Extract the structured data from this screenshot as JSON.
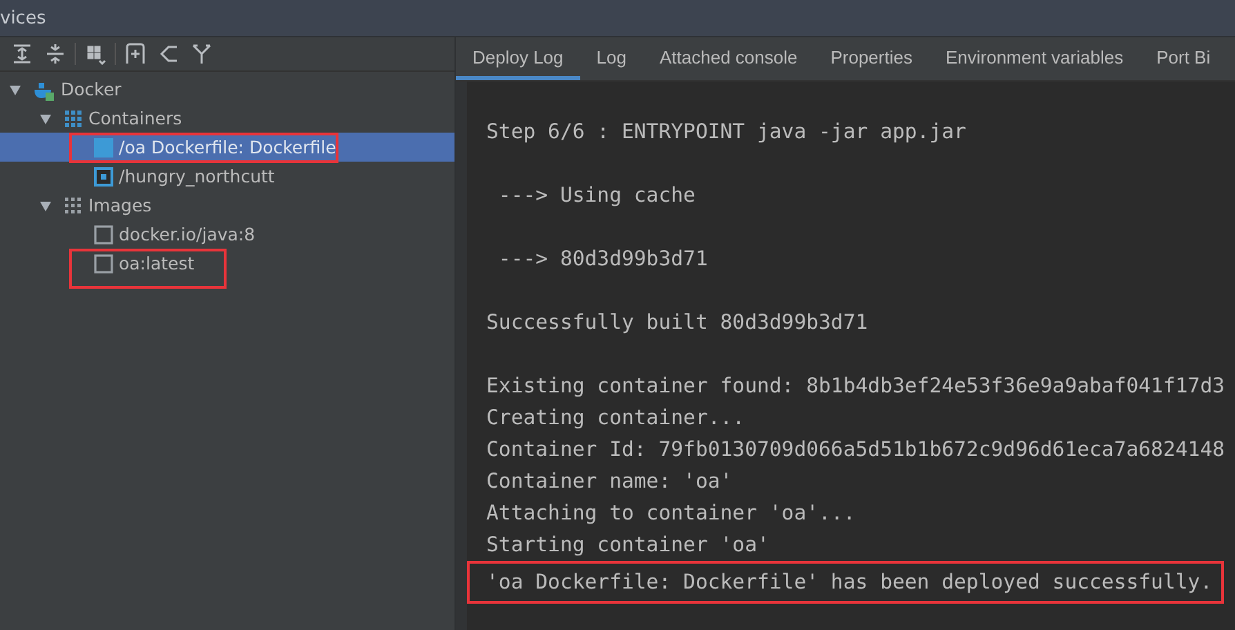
{
  "window": {
    "title": "vices"
  },
  "toolbar": {
    "buttons": [
      {
        "kind": "expand"
      },
      {
        "kind": "collapse"
      },
      {
        "kind": "group"
      },
      {
        "kind": "add"
      },
      {
        "kind": "share"
      },
      {
        "kind": "filter"
      }
    ]
  },
  "tree": [
    {
      "label": "Docker",
      "kind": "docker",
      "expanded": true,
      "selected": false,
      "highlighted": false,
      "children": [
        {
          "label": "Containers",
          "kind": "containers",
          "expanded": true,
          "selected": false,
          "highlighted": false,
          "children": [
            {
              "label": "/oa Dockerfile: Dockerfile",
              "kind": "container-stopped",
              "selected": true,
              "highlighted": true
            },
            {
              "label": "/hungry_northcutt",
              "kind": "container-running",
              "selected": false,
              "highlighted": false
            }
          ]
        },
        {
          "label": "Images",
          "kind": "images",
          "expanded": true,
          "selected": false,
          "highlighted": false,
          "children": [
            {
              "label": "docker.io/java:8",
              "kind": "image",
              "selected": false,
              "highlighted": false
            },
            {
              "label": "oa:latest",
              "kind": "image",
              "selected": false,
              "highlighted": true
            }
          ]
        }
      ]
    }
  ],
  "tabs": [
    {
      "label": "Deploy Log",
      "selected": true
    },
    {
      "label": "Log",
      "selected": false
    },
    {
      "label": "Attached console",
      "selected": false
    },
    {
      "label": "Properties",
      "selected": false
    },
    {
      "label": "Environment variables",
      "selected": false
    },
    {
      "label": "Port Bi",
      "selected": false
    }
  ],
  "log": [
    {
      "lines": [
        {
          "text": "Step 6/6 : ENTRYPOINT java -jar app.jar",
          "highlighted": false
        }
      ]
    },
    {
      "lines": [
        {
          "text": " ---> Using cache",
          "highlighted": false
        }
      ]
    },
    {
      "lines": [
        {
          "text": " ---> 80d3d99b3d71",
          "highlighted": false
        }
      ]
    },
    {
      "lines": [
        {
          "text": "Successfully built 80d3d99b3d71",
          "highlighted": false
        }
      ]
    },
    {
      "lines": [
        {
          "text": "Existing container found: 8b1b4db3ef24e53f36e9a9abaf041f17d3",
          "highlighted": false
        },
        {
          "text": "Creating container...",
          "highlighted": false
        },
        {
          "text": "Container Id: 79fb0130709d066a5d51b1b672c9d96d61eca7a6824148",
          "highlighted": false
        },
        {
          "text": "Container name: 'oa'",
          "highlighted": false
        },
        {
          "text": "Attaching to container 'oa'...",
          "highlighted": false
        },
        {
          "text": "Starting container 'oa'",
          "highlighted": false
        },
        {
          "text": "'oa Dockerfile: Dockerfile' has been deployed successfully.",
          "highlighted": true
        }
      ]
    }
  ]
}
